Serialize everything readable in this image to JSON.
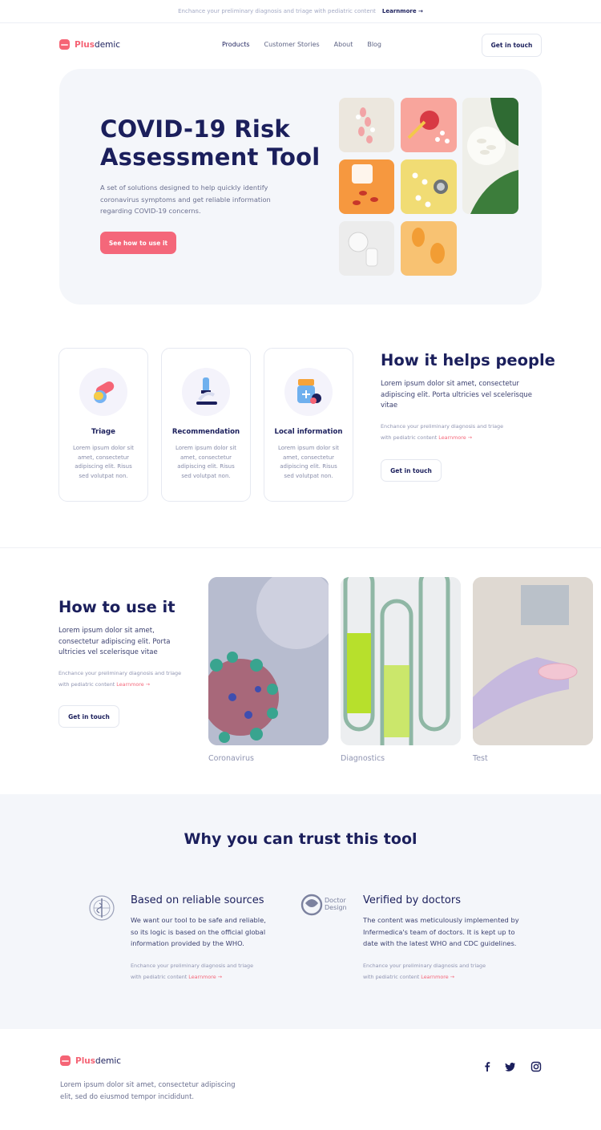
{
  "topbar": {
    "text": "Enchance your preliminary diagnosis and triage with pediatric content",
    "link": "Learnmore",
    "arrow": "→"
  },
  "nav": {
    "logo_plus": "Plus",
    "logo_demic": "demic",
    "items": [
      "Products",
      "Customer Stories",
      "About",
      "Blog"
    ],
    "cta": "Get in touch"
  },
  "hero": {
    "title": "COVID-19 Risk Assessment Tool",
    "description": "A set of solutions designed to help quickly identify coronavirus symptoms and get reliable information regarding COVID-19 concerns.",
    "button": "See how to use it"
  },
  "features": [
    {
      "title": "Triage",
      "text": "Lorem ipsum dolor sit amet, consectetur adipiscing elit. Risus sed volutpat non.",
      "icon": "pills-icon"
    },
    {
      "title": "Recommendation",
      "text": "Lorem ipsum dolor sit amet, consectetur adipiscing elit. Risus sed volutpat non.",
      "icon": "microscope-icon"
    },
    {
      "title": "Local information",
      "text": "Lorem ipsum dolor sit amet, consectetur adipiscing elit. Risus sed volutpat non.",
      "icon": "medicine-bottle-icon"
    }
  ],
  "helps": {
    "title": "How it helps people",
    "text": "Lorem ipsum dolor sit amet, consectetur adipiscing elit. Porta ultricies vel scelerisque vitae",
    "small": "Enchance your preliminary diagnosis and triage with pediatric content",
    "link": "Learnmore →",
    "button": "Get in touch"
  },
  "howto": {
    "title": "How to use it",
    "text": "Lorem ipsum dolor sit amet, consectetur adipiscing elit. Porta ultricies vel scelerisque vitae",
    "small": "Enchance your preliminary diagnosis and triage with pediatric content",
    "link": "Learnmore →",
    "button": "Get in touch",
    "cards": [
      "Coronavirus",
      "Diagnostics",
      "Test"
    ]
  },
  "trust": {
    "title": "Why you can trust this tool",
    "cols": [
      {
        "title": "Based on reliable sources",
        "text": "We want our tool to be safe and reliable, so its logic is based on the official global information provided by the WHO.",
        "small": "Enchance your preliminary diagnosis and triage with pediatric content",
        "link": "Learnmore →",
        "logo": "who-emblem-icon"
      },
      {
        "title": "Verified by doctors",
        "text": "The content was meticulously implemented by Infermedica's team of doctors. It is kept up to date with the latest WHO and CDC guidelines.",
        "small": "Enchance your preliminary diagnosis and triage with pediatric content",
        "link": "Learnmore →",
        "logo": "doctor-design-logo",
        "logo_text_1": "Doctor",
        "logo_text_2": "Design"
      }
    ]
  },
  "footer": {
    "logo_plus": "Plus",
    "logo_demic": "demic",
    "text": "Lorem ipsum dolor sit amet, consectetur adipiscing elit, sed do eiusmod tempor incididunt.",
    "social": [
      "facebook-icon",
      "twitter-icon",
      "instagram-icon"
    ]
  },
  "colors": {
    "navy": "#1b1f5c",
    "coral": "#f4677a",
    "panel": "#f4f6fa"
  }
}
